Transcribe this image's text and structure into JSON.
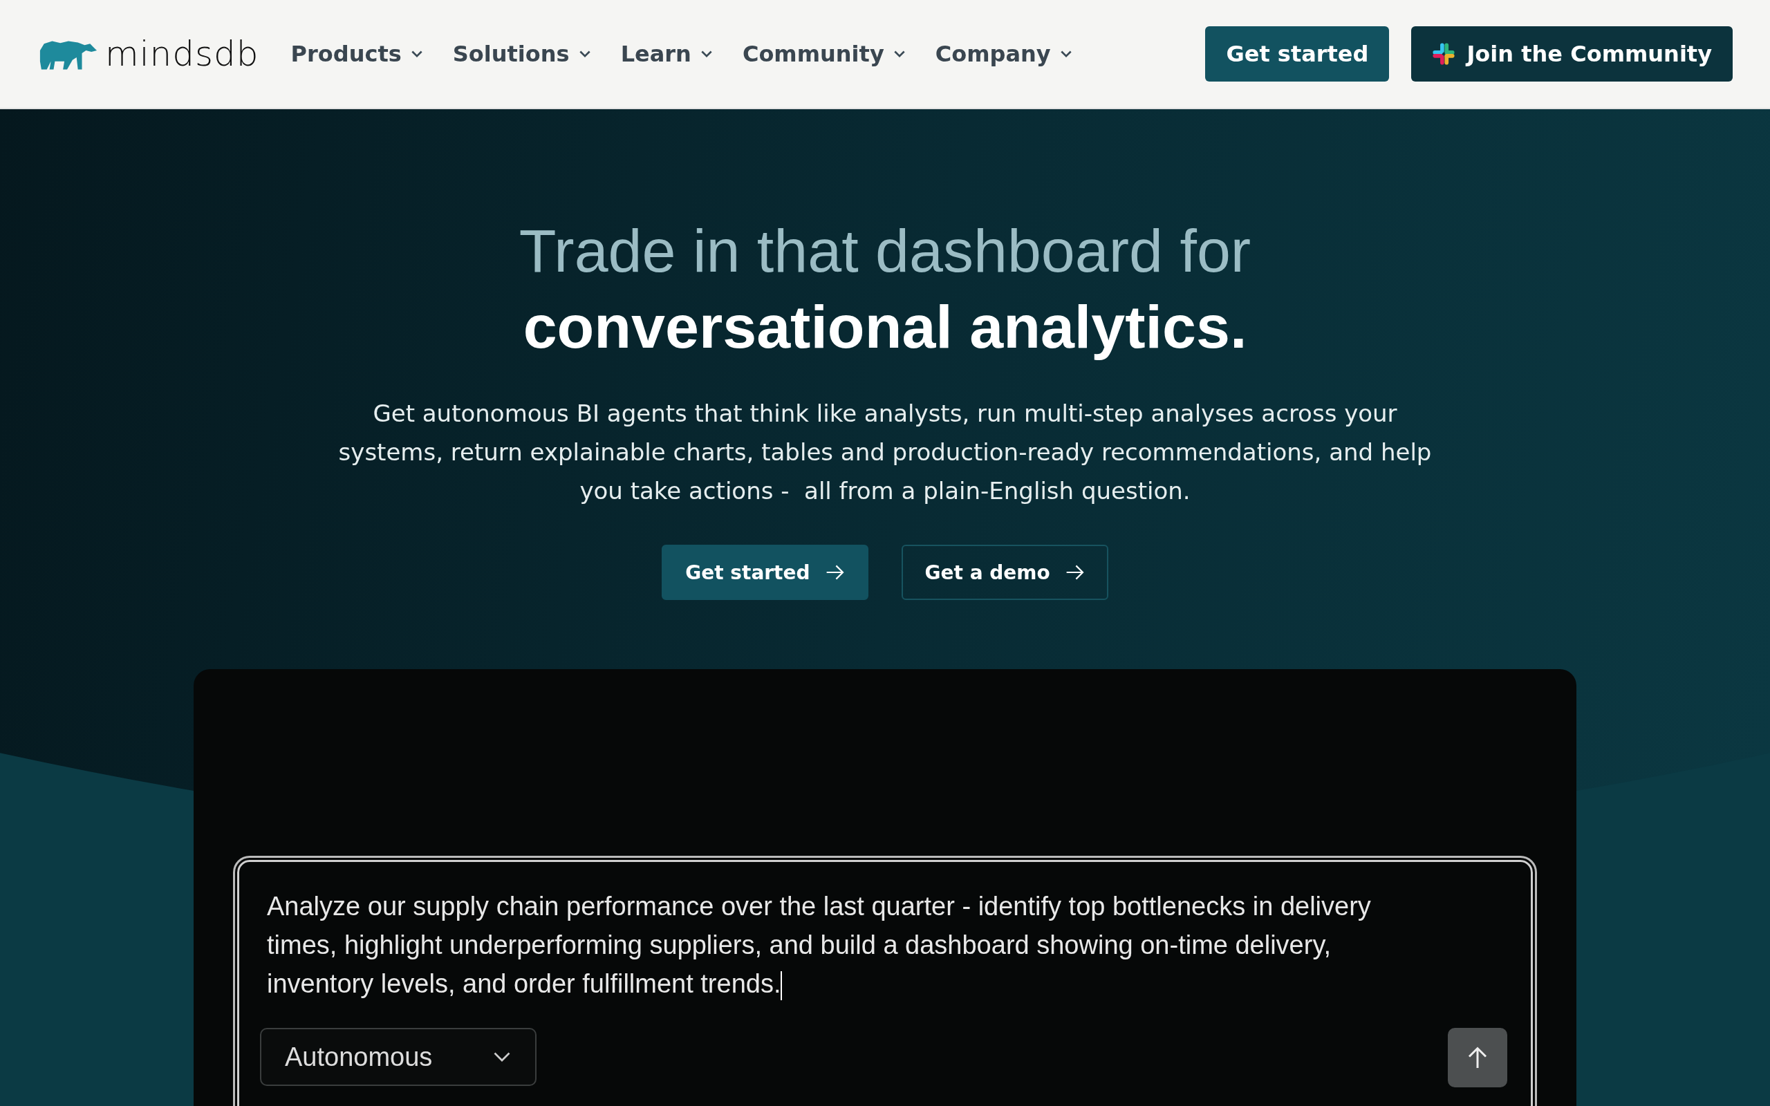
{
  "nav": {
    "logo": "mindsdb",
    "items": [
      {
        "label": "Products"
      },
      {
        "label": "Solutions"
      },
      {
        "label": "Learn"
      },
      {
        "label": "Community"
      },
      {
        "label": "Company"
      }
    ],
    "primary_button": "Get started",
    "community_button": "Join the Community"
  },
  "hero": {
    "title_line1": "Trade in that dashboard for",
    "title_line2": "conversational analytics.",
    "description": "Get autonomous BI agents that think like analysts, run multi-step analyses across your systems, return explainable charts, tables and production-ready recommendations, and help you take actions -  all from a plain-English question.",
    "buttons": [
      {
        "label": "Get started",
        "kind": "primary"
      },
      {
        "label": "Get a demo",
        "kind": "outline"
      }
    ]
  },
  "chat": {
    "prompt": {
      "value": "Analyze our supply chain performance over the last quarter - identify top bottlenecks in delivery times, highlight underperforming suppliers, and build a dashboard showing on-time delivery, inventory levels, and order fulfillment trends."
    },
    "mode": {
      "value": "Autonomous"
    }
  }
}
